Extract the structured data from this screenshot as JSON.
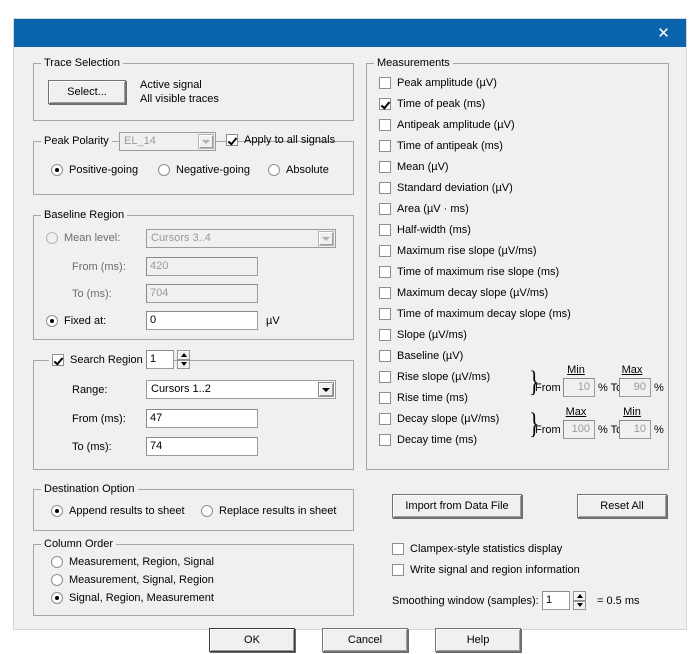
{
  "window": {
    "title": "",
    "close_icon": "close-icon"
  },
  "trace_selection": {
    "legend": "Trace Selection",
    "select_button": "Select...",
    "info_line1": "Active signal",
    "info_line2": "All visible traces"
  },
  "peak_polarity": {
    "legend": "Peak Polarity",
    "signal_value": "EL_14",
    "apply_all_label": "Apply to all signals",
    "apply_all_checked": true,
    "options": [
      {
        "label": "Positive-going",
        "selected": true
      },
      {
        "label": "Negative-going",
        "selected": false
      },
      {
        "label": "Absolute",
        "selected": false
      }
    ]
  },
  "baseline_region": {
    "legend": "Baseline Region",
    "mean_level_label": "Mean level:",
    "mean_level_selected": false,
    "mean_level_value": "Cursors 3..4",
    "from_label": "From (ms):",
    "from_value": "420",
    "to_label": "To (ms):",
    "to_value": "704",
    "fixed_at_label": "Fixed at:",
    "fixed_at_selected": true,
    "fixed_at_value": "0",
    "fixed_at_units": "µV"
  },
  "search_region": {
    "legend": "Search Region",
    "enabled": true,
    "index_value": "1",
    "range_label": "Range:",
    "range_value": "Cursors 1..2",
    "from_label": "From (ms):",
    "from_value": "47",
    "to_label": "To (ms):",
    "to_value": "74"
  },
  "measurements": {
    "legend": "Measurements",
    "items": [
      {
        "label": "Peak amplitude (µV)",
        "checked": false
      },
      {
        "label": "Time of peak (ms)",
        "checked": true
      },
      {
        "label": "Antipeak amplitude (µV)",
        "checked": false
      },
      {
        "label": "Time of antipeak (ms)",
        "checked": false
      },
      {
        "label": "Mean (µV)",
        "checked": false
      },
      {
        "label": "Standard deviation (µV)",
        "checked": false
      },
      {
        "label": "Area (µV · ms)",
        "checked": false
      },
      {
        "label": "Half-width (ms)",
        "checked": false
      },
      {
        "label": "Maximum rise slope (µV/ms)",
        "checked": false
      },
      {
        "label": "Time of maximum rise slope (ms)",
        "checked": false
      },
      {
        "label": "Maximum decay slope (µV/ms)",
        "checked": false
      },
      {
        "label": "Time of maximum decay slope (ms)",
        "checked": false
      },
      {
        "label": "Slope (µV/ms)",
        "checked": false
      },
      {
        "label": "Baseline (µV)",
        "checked": false
      },
      {
        "label": "Rise slope (µV/ms)",
        "checked": false
      },
      {
        "label": "Rise time (ms)",
        "checked": false
      },
      {
        "label": "Decay slope (µV/ms)",
        "checked": false
      },
      {
        "label": "Decay time (ms)",
        "checked": false
      }
    ],
    "rise_range": {
      "from_label": "From",
      "to_label": "% To",
      "pct_label": "%",
      "from_cap": "Min",
      "to_cap": "Max",
      "from_value": "10",
      "to_value": "90"
    },
    "decay_range": {
      "from_label": "From",
      "to_label": "% To",
      "pct_label": "%",
      "from_cap": "Max",
      "to_cap": "Min",
      "from_value": "100",
      "to_value": "10"
    }
  },
  "destination_option": {
    "legend": "Destination Option",
    "options": [
      {
        "label": "Append results to sheet",
        "selected": true
      },
      {
        "label": "Replace results in sheet",
        "selected": false
      }
    ]
  },
  "column_order": {
    "legend": "Column Order",
    "options": [
      {
        "label": "Measurement, Region, Signal",
        "selected": false
      },
      {
        "label": "Measurement, Signal, Region",
        "selected": false
      },
      {
        "label": "Signal, Region, Measurement",
        "selected": true
      }
    ]
  },
  "right_actions": {
    "import_button": "Import from Data File",
    "reset_button": "Reset All",
    "clampex_label": "Clampex-style statistics display",
    "clampex_checked": false,
    "write_info_label": "Write signal and region information",
    "write_info_checked": false,
    "smoothing_label": "Smoothing window (samples):",
    "smoothing_value": "1",
    "smoothing_result": "= 0.5 ms"
  },
  "footer": {
    "ok_button": "OK",
    "cancel_button": "Cancel",
    "help_button": "Help"
  }
}
